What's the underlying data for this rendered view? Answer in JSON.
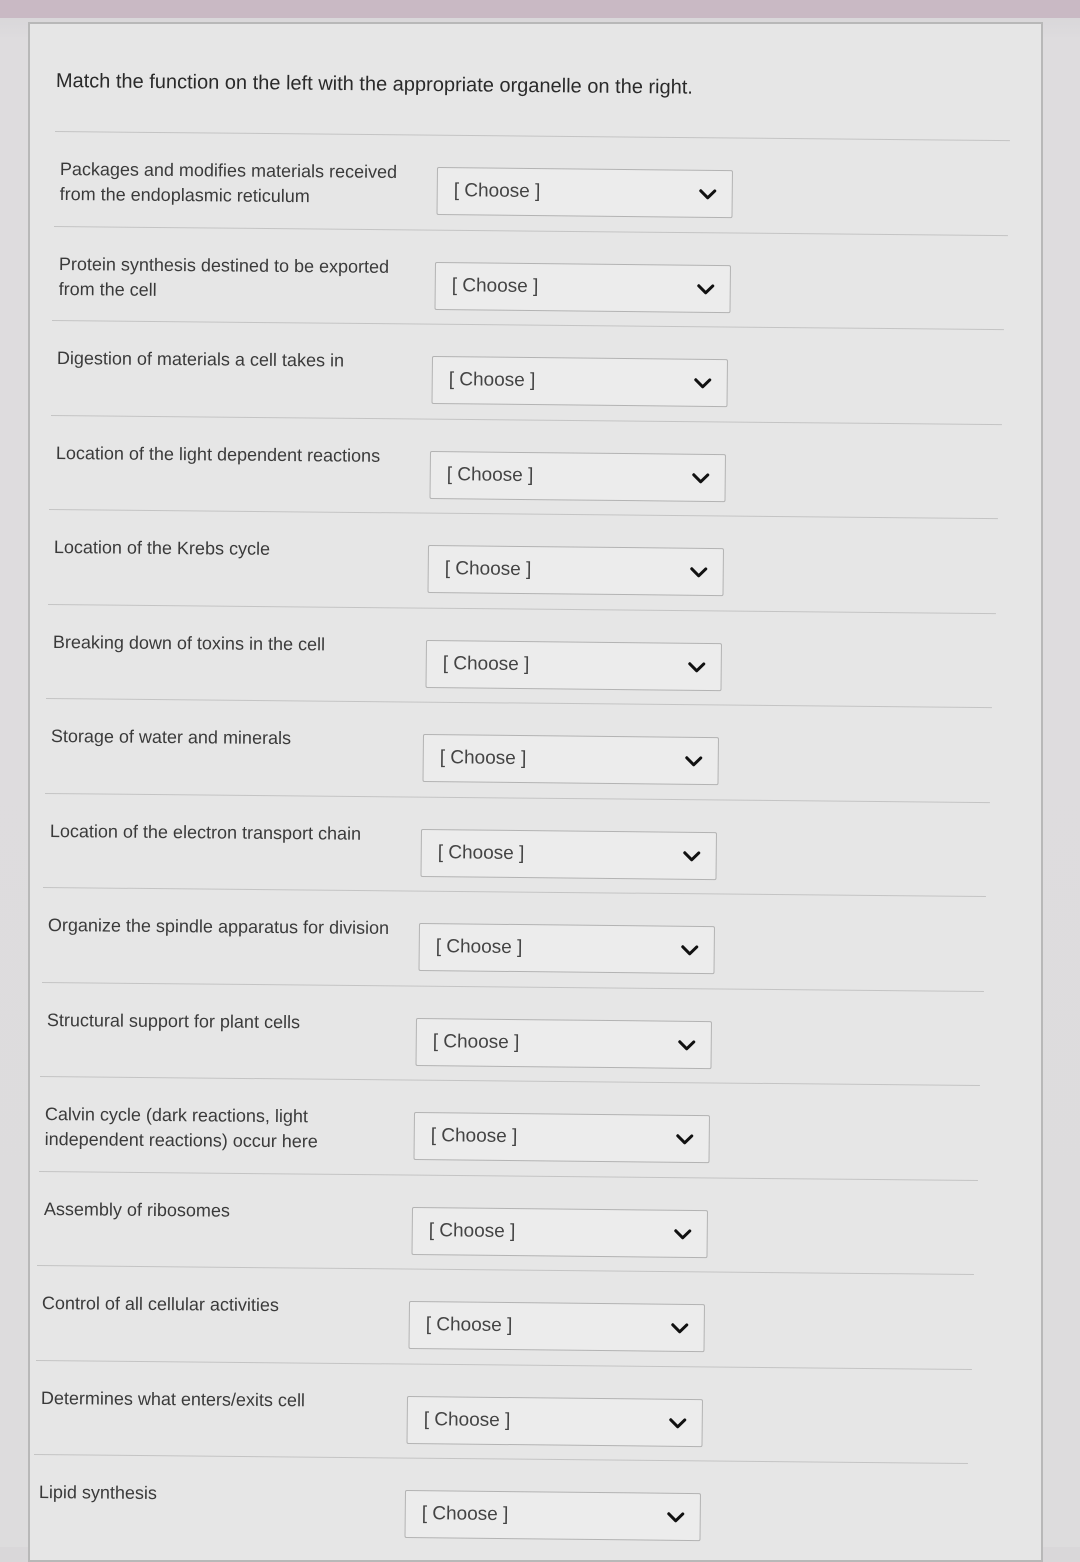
{
  "question": "Match the function on the left with the appropriate organelle on the right.",
  "rows": [
    {
      "prompt": "Packages and modifies materials received from the endoplasmic reticulum",
      "selected": "[ Choose ]"
    },
    {
      "prompt": "Protein synthesis destined to be exported from the cell",
      "selected": "[ Choose ]"
    },
    {
      "prompt": "Digestion of materials a cell takes in",
      "selected": "[ Choose ]"
    },
    {
      "prompt": "Location of the light dependent reactions",
      "selected": "[ Choose ]"
    },
    {
      "prompt": "Location of the Krebs cycle",
      "selected": "[ Choose ]"
    },
    {
      "prompt": "Breaking down of toxins in the cell",
      "selected": "[ Choose ]"
    },
    {
      "prompt": "Storage of water and minerals",
      "selected": "[ Choose ]"
    },
    {
      "prompt": "Location of the electron transport chain",
      "selected": "[ Choose ]"
    },
    {
      "prompt": "Organize the spindle apparatus for division",
      "selected": "[ Choose ]"
    },
    {
      "prompt": "Structural support for plant cells",
      "selected": "[ Choose ]"
    },
    {
      "prompt": "Calvin cycle (dark reactions, light independent reactions) occur here",
      "selected": "[ Choose ]"
    },
    {
      "prompt": "Assembly of ribosomes",
      "selected": "[ Choose ]"
    },
    {
      "prompt": "Control of all cellular activities",
      "selected": "[ Choose ]"
    },
    {
      "prompt": "Determines what enters/exits cell",
      "selected": "[ Choose ]"
    },
    {
      "prompt": "Lipid synthesis",
      "selected": "[ Choose ]"
    }
  ]
}
